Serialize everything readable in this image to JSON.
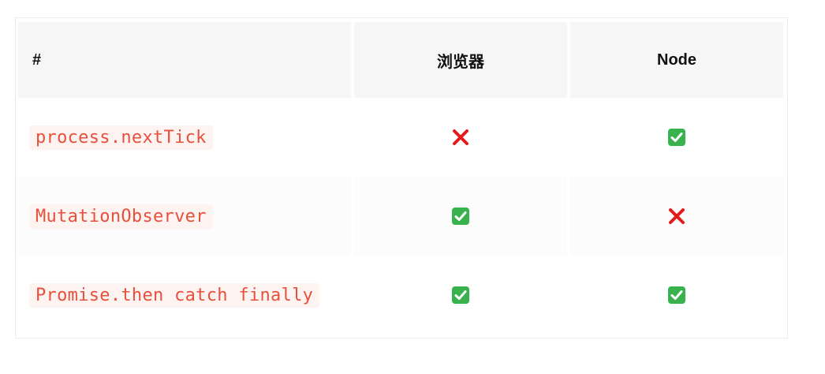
{
  "table": {
    "headers": [
      "#",
      "浏览器",
      "Node"
    ],
    "rows": [
      {
        "name": "process.nextTick",
        "browser": "cross",
        "node": "check"
      },
      {
        "name": "MutationObserver",
        "browser": "check",
        "node": "cross"
      },
      {
        "name": "Promise.then catch finally",
        "browser": "check",
        "node": "check"
      }
    ]
  },
  "colors": {
    "code_text": "#e8503e",
    "code_bg": "#fdf3f1",
    "check_green": "#37b24d",
    "cross_red": "#e41b1b",
    "header_bg": "#f6f6f6"
  },
  "icons": {
    "check": "white-check-mark-icon",
    "cross": "cross-mark-icon"
  }
}
